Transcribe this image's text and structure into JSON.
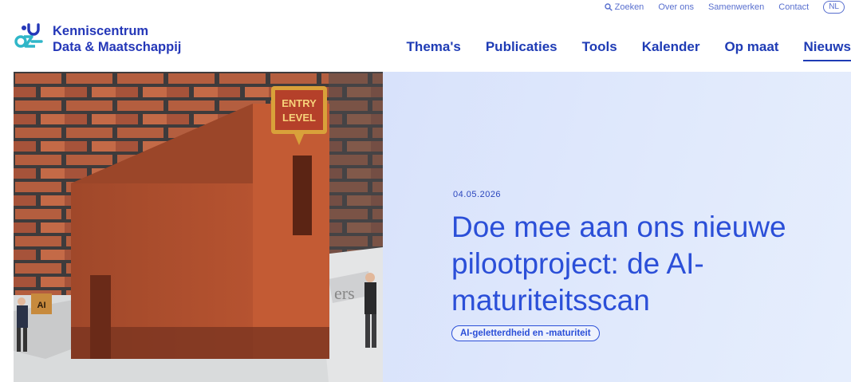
{
  "utility": {
    "search_label": "Zoeken",
    "about_label": "Over ons",
    "collab_label": "Samenwerken",
    "contact_label": "Contact",
    "language": "NL"
  },
  "logo": {
    "line1": "Kenniscentrum",
    "line2": "Data & Maatschappij"
  },
  "nav": {
    "items": [
      "Thema's",
      "Publicaties",
      "Tools",
      "Kalender",
      "Op maat",
      "Nieuws"
    ],
    "active_index": 5
  },
  "hero": {
    "image_sign_line1": "ENTRY",
    "image_sign_line2": "LEVEL",
    "image_box_label": "AI",
    "date": "04.05.2026",
    "headline": "Doe mee aan ons nieuwe pilootproject: de AI-maturiteitsscan",
    "tag": "AI-geletterdheid en -maturiteit"
  },
  "colors": {
    "brand_blue": "#1f3cb5",
    "headline_blue": "#2b4fd8",
    "panel_bg": "#dfe8fc",
    "logo_teal": "#2fb6c8"
  }
}
